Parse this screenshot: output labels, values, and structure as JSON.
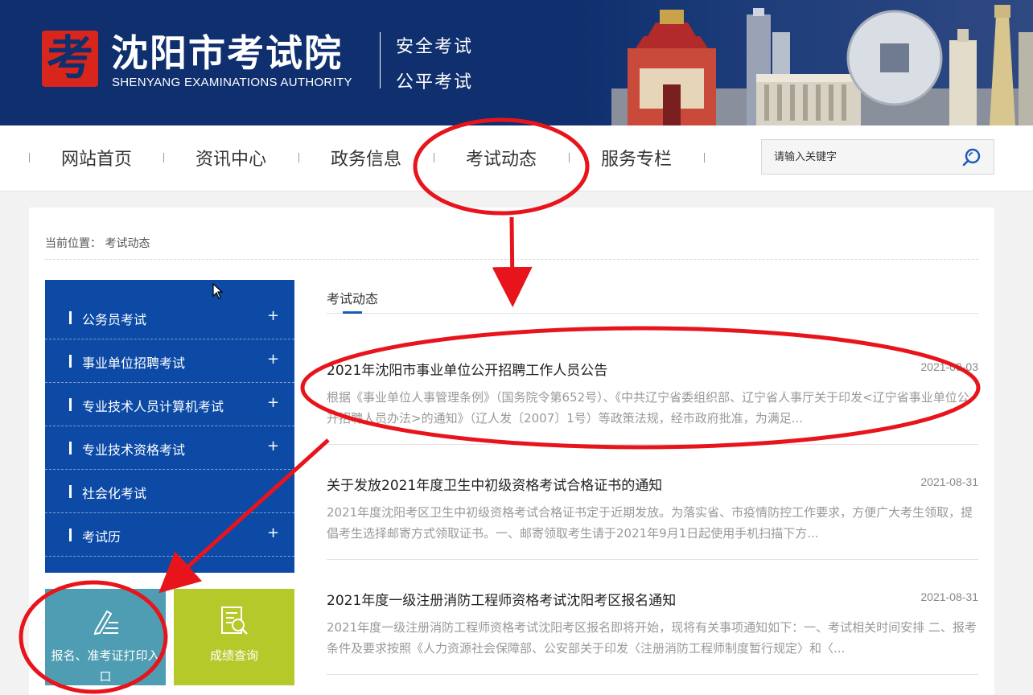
{
  "header": {
    "logo_glyph": "考",
    "title": "沈阳市考试院",
    "subtitle": "SHENYANG EXAMINATIONS AUTHORITY",
    "slogan_line1": "安全考试",
    "slogan_line2": "公平考试"
  },
  "nav": {
    "items": [
      {
        "label": "网站首页"
      },
      {
        "label": "资讯中心"
      },
      {
        "label": "政务信息"
      },
      {
        "label": "考试动态"
      },
      {
        "label": "服务专栏"
      }
    ],
    "search_placeholder": "请输入关键字",
    "search_icon": "search-icon"
  },
  "breadcrumb": {
    "prefix": "当前位置：",
    "current": "考试动态"
  },
  "sidebar": {
    "items": [
      {
        "label": "公务员考试",
        "expand": "+"
      },
      {
        "label": "事业单位招聘考试",
        "expand": "+"
      },
      {
        "label": "专业技术人员计算机考试",
        "expand": "+"
      },
      {
        "label": "专业技术资格考试",
        "expand": "+"
      },
      {
        "label": "社会化考试",
        "expand": ""
      },
      {
        "label": "考试历",
        "expand": "+"
      }
    ]
  },
  "tiles": {
    "registration": {
      "label_line1": "报名、准考证打印入",
      "label_line2": "口",
      "icon": "pen-list-icon",
      "color": "#4f9db2"
    },
    "scores": {
      "label": "成绩查询",
      "icon": "document-search-icon",
      "color": "#b6c92a"
    }
  },
  "content": {
    "section_title": "考试动态",
    "news": [
      {
        "title": "2021年沈阳市事业单位公开招聘工作人员公告",
        "date": "2021-09-03",
        "desc": "根据《事业单位人事管理条例》（国务院令第652号）、《中共辽宁省委组织部、辽宁省人事厅关于印发<辽宁省事业单位公开招聘人员办法>的通知》（辽人发〔2007〕1号）等政策法规，经市政府批准，为满足..."
      },
      {
        "title": "关于发放2021年度卫生中初级资格考试合格证书的通知",
        "date": "2021-08-31",
        "desc": "2021年度沈阳考区卫生中初级资格考试合格证书定于近期发放。为落实省、市疫情防控工作要求，方便广大考生领取，提倡考生选择邮寄方式领取证书。一、邮寄领取考生请于2021年9月1日起使用手机扫描下方..."
      },
      {
        "title": "2021年度一级注册消防工程师资格考试沈阳考区报名通知",
        "date": "2021-08-31",
        "desc": "2021年度一级注册消防工程师资格考试沈阳考区报名即将开始，现将有关事项通知如下：一、考试相关时间安排 二、报考条件及要求按照《人力资源社会保障部、公安部关于印发〈注册消防工程师制度暂行规定〉和〈..."
      }
    ]
  },
  "colors": {
    "header_bg": "#0f2f6e",
    "sidebar_bg": "#0c4aa6",
    "annotation_red": "#e8141c",
    "accent_blue": "#1a5bb8"
  }
}
